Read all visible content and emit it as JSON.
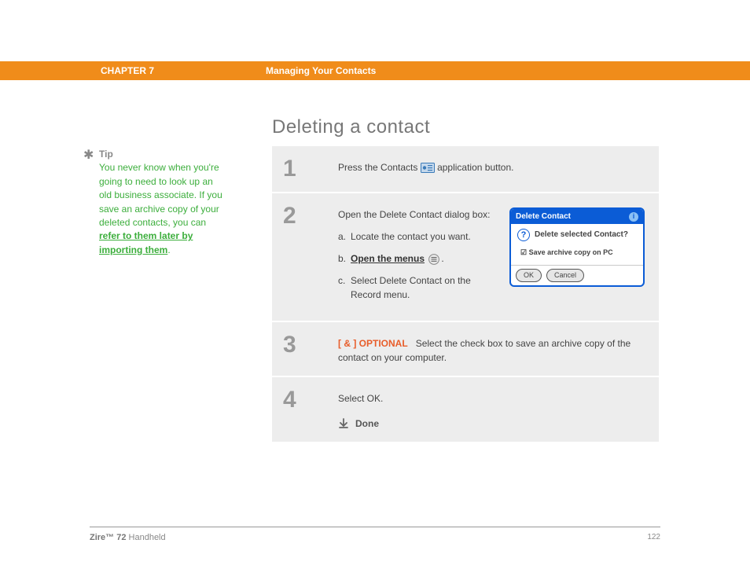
{
  "header": {
    "chapter": "CHAPTER 7",
    "title": "Managing Your Contacts"
  },
  "page_title": "Deleting a contact",
  "tip": {
    "label": "Tip",
    "text": "You never know when you're going to need to look up an old business associate. If you save an archive copy of your deleted contacts, you can ",
    "link": "refer to them later by importing them",
    "suffix": "."
  },
  "steps": [
    {
      "num": "1",
      "text_before": "Press the Contacts ",
      "text_after": " application button."
    },
    {
      "num": "2",
      "intro": "Open the Delete Contact dialog box:",
      "sub_a": "Locate the contact you want.",
      "sub_b_link": "Open the menus",
      "sub_b_suffix": ".",
      "sub_c": "Select Delete Contact on the Record menu."
    },
    {
      "num": "3",
      "optional": "[ & ]  OPTIONAL",
      "text": "Select the check box to save an archive copy of the contact on your computer."
    },
    {
      "num": "4",
      "text": "Select OK.",
      "done": "Done"
    }
  ],
  "dialog": {
    "title": "Delete Contact",
    "question": "Delete selected Contact?",
    "checkbox_label": "Save archive copy on PC",
    "ok": "OK",
    "cancel": "Cancel"
  },
  "footer": {
    "product_bold": "Zire™ 72",
    "product_rest": " Handheld",
    "page": "122"
  }
}
